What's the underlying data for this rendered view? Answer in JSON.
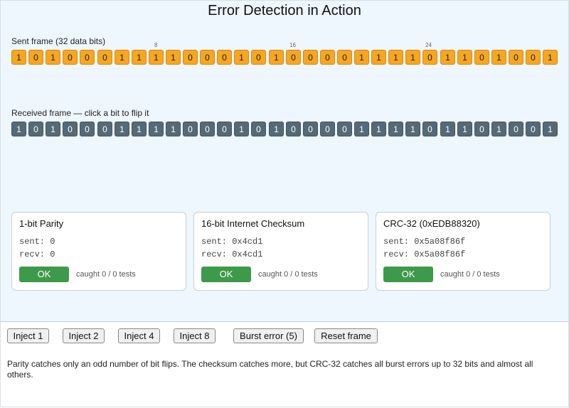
{
  "title": "Error Detection in Action",
  "sent": {
    "label": "Sent frame (32 data bits)",
    "ticks": [
      "8",
      "16",
      "24"
    ],
    "bits": [
      "1",
      "0",
      "1",
      "0",
      "0",
      "0",
      "1",
      "1",
      "1",
      "1",
      "0",
      "0",
      "0",
      "1",
      "0",
      "1",
      "0",
      "0",
      "0",
      "0",
      "1",
      "1",
      "1",
      "1",
      "0",
      "1",
      "1",
      "0",
      "1",
      "0",
      "0",
      "1"
    ]
  },
  "received": {
    "label": "Received frame — click a bit to flip it",
    "bits": [
      "1",
      "0",
      "1",
      "0",
      "0",
      "0",
      "1",
      "1",
      "1",
      "1",
      "0",
      "0",
      "0",
      "1",
      "0",
      "1",
      "0",
      "0",
      "0",
      "0",
      "1",
      "1",
      "1",
      "1",
      "0",
      "1",
      "1",
      "0",
      "1",
      "0",
      "0",
      "1"
    ]
  },
  "cards": [
    {
      "title": "1-bit Parity",
      "sent": "sent: 0",
      "recv": "recv: 0",
      "status": "OK",
      "caught": "caught 0 / 0 tests"
    },
    {
      "title": "16-bit Internet Checksum",
      "sent": "sent: 0x4cd1",
      "recv": "recv: 0x4cd1",
      "status": "OK",
      "caught": "caught 0 / 0 tests"
    },
    {
      "title": "CRC-32 (0xEDB88320)",
      "sent": "sent: 0x5a08f86f",
      "recv": "recv: 0x5a08f86f",
      "status": "OK",
      "caught": "caught 0 / 0 tests"
    }
  ],
  "buttons": {
    "inject1": "Inject 1",
    "inject2": "Inject 2",
    "inject4": "Inject 4",
    "inject8": "Inject 8",
    "burst": "Burst error (5)",
    "reset": "Reset frame"
  },
  "note": "Parity catches only an odd number of bit flips. The checksum catches more, but CRC-32 catches all burst errors up to 32 bits and almost all others.",
  "colors": {
    "sent_bit": "#f5a623",
    "received_bit": "#556a78",
    "ok": "#3d9a4a",
    "panel_bg": "#eef6fe"
  }
}
